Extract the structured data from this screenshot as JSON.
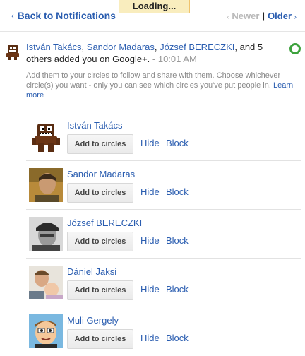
{
  "topbar": {
    "back_label": "Back to Notifications",
    "loading_label": "Loading...",
    "newer_label": "Newer",
    "separator": "|",
    "older_label": "Older"
  },
  "icons": {
    "back_chevron": "‹",
    "older_chevron": "›",
    "newer_chevron": "‹"
  },
  "notification": {
    "actor1": "István Takács",
    "sep1": ",",
    "actor2": "Sandor Madaras",
    "sep2": ",",
    "actor3": "József BERECZKI",
    "rest": ", and 5 others added you on Google+.",
    "dash": " - ",
    "time": "10:01 AM",
    "description": "Add them to your circles to follow and share with them. Choose whichever circle(s) you want - only you can see which circles you've put people in.",
    "learn_more": "Learn more",
    "status_color": "#3da23d"
  },
  "people": [
    {
      "name": "István Takács",
      "add_label": "Add to circles",
      "hide_label": "Hide",
      "block_label": "Block",
      "avatar": "robot-avatar"
    },
    {
      "name": "Sandor Madaras",
      "add_label": "Add to circles",
      "hide_label": "Hide",
      "block_label": "Block",
      "avatar": "photo-avatar"
    },
    {
      "name": "József BERECZKI",
      "add_label": "Add to circles",
      "hide_label": "Hide",
      "block_label": "Block",
      "avatar": "photo-avatar"
    },
    {
      "name": "Dániel Jaksi",
      "add_label": "Add to circles",
      "hide_label": "Hide",
      "block_label": "Block",
      "avatar": "photo-avatar"
    },
    {
      "name": "Muli Gergely",
      "add_label": "Add to circles",
      "hide_label": "Hide",
      "block_label": "Block",
      "avatar": "cartoon-avatar"
    }
  ],
  "colors": {
    "link": "#2a5db0",
    "loading_bg": "#f9edbe",
    "status_ring": "#3da23d"
  }
}
